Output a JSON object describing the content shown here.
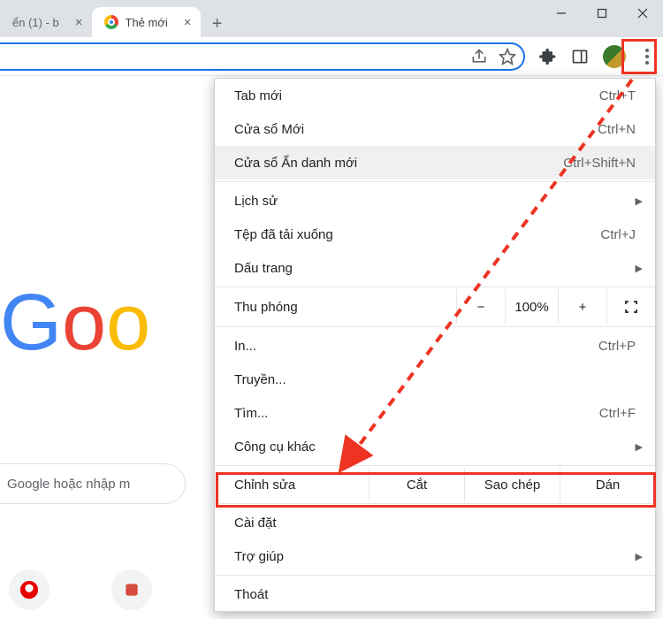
{
  "tabs": [
    {
      "title": "ển (1) - b",
      "active": false
    },
    {
      "title": "Thẻ mới",
      "active": true
    }
  ],
  "page": {
    "logo_letters": [
      "G",
      "o",
      "o"
    ],
    "search_placeholder": "Google hoặc nhập m"
  },
  "menu": {
    "new_tab": {
      "label": "Tab mới",
      "shortcut": "Ctrl+T"
    },
    "new_window": {
      "label": "Cửa sổ Mới",
      "shortcut": "Ctrl+N"
    },
    "incognito": {
      "label": "Cửa sổ Ẩn danh mới",
      "shortcut": "Ctrl+Shift+N"
    },
    "history": {
      "label": "Lịch sử"
    },
    "downloads": {
      "label": "Tệp đã tải xuống",
      "shortcut": "Ctrl+J"
    },
    "bookmarks": {
      "label": "Dấu trang"
    },
    "zoom": {
      "label": "Thu phóng",
      "value": "100%",
      "minus": "−",
      "plus": "+"
    },
    "print": {
      "label": "In...",
      "shortcut": "Ctrl+P"
    },
    "cast": {
      "label": "Truyền..."
    },
    "find": {
      "label": "Tìm...",
      "shortcut": "Ctrl+F"
    },
    "more_tools": {
      "label": "Công cụ khác"
    },
    "edit": {
      "label": "Chỉnh sửa",
      "cut": "Cắt",
      "copy": "Sao chép",
      "paste": "Dán"
    },
    "settings": {
      "label": "Cài đặt"
    },
    "help": {
      "label": "Trợ giúp"
    },
    "exit": {
      "label": "Thoát"
    }
  }
}
